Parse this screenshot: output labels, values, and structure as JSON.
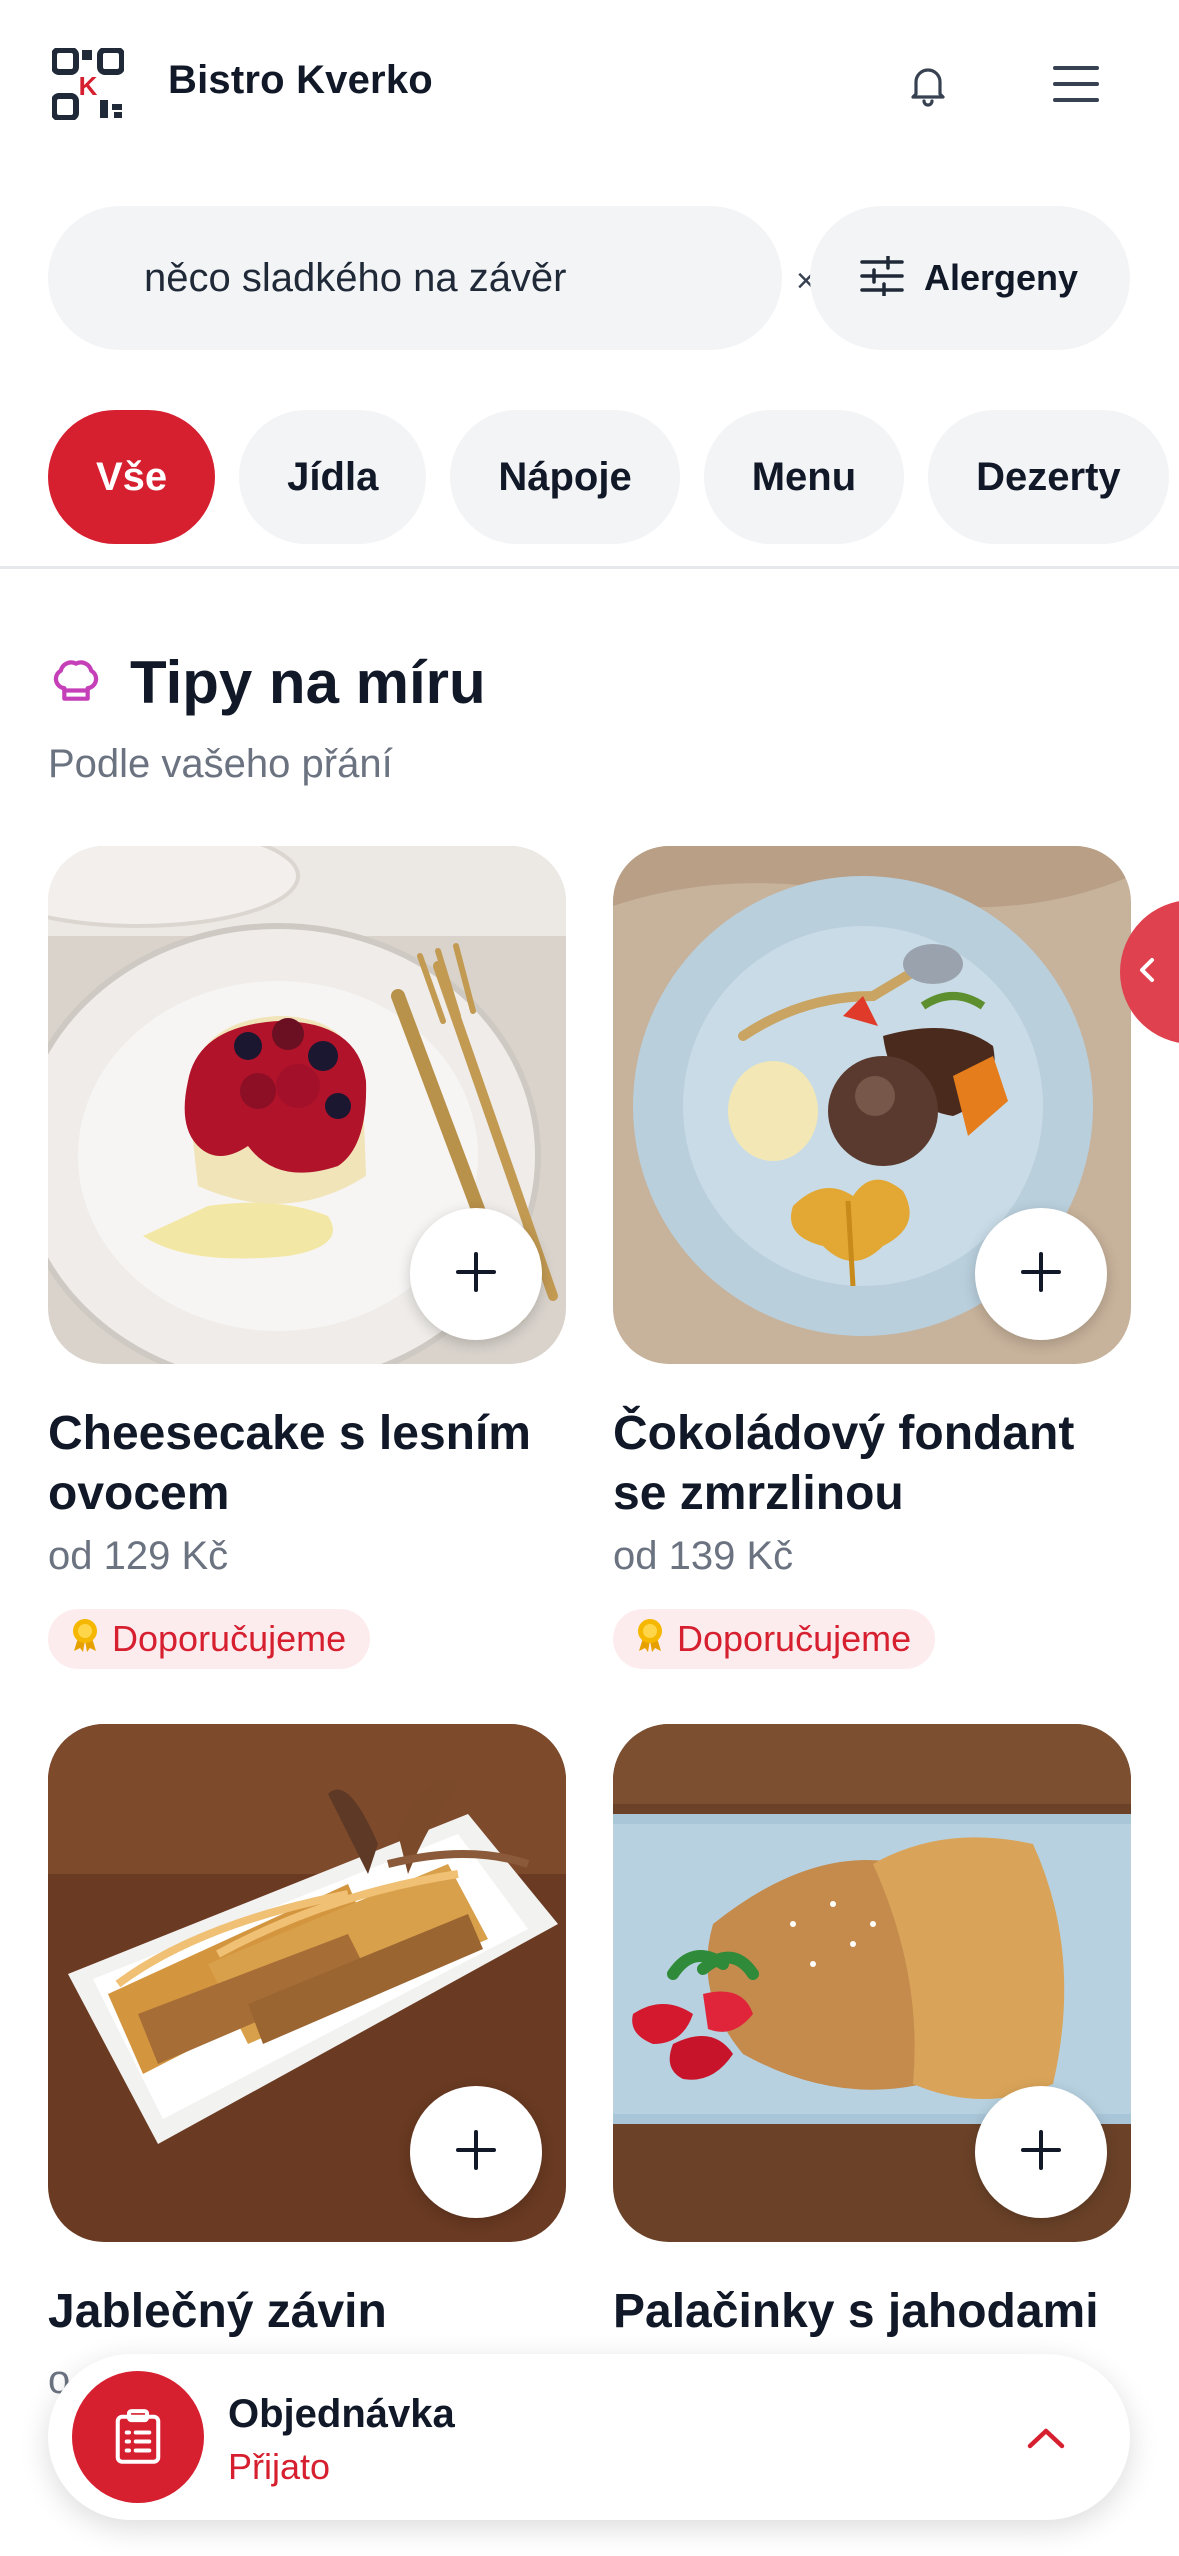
{
  "header": {
    "brand": "Bistro Kverko"
  },
  "search": {
    "query": "něco sladkého na závěr",
    "clear_glyph": "×"
  },
  "filters": {
    "allergens_label": "Alergeny"
  },
  "categories": [
    {
      "label": "Vše",
      "active": true
    },
    {
      "label": "Jídla",
      "active": false
    },
    {
      "label": "Nápoje",
      "active": false
    },
    {
      "label": "Menu",
      "active": false
    },
    {
      "label": "Dezerty",
      "active": false
    }
  ],
  "section": {
    "title": "Tipy na míru",
    "subtitle": "Podle vašeho přání"
  },
  "products": [
    {
      "name": "Cheesecake s lesním ovocem",
      "price": "od 129 Kč",
      "badge": "Doporučujeme"
    },
    {
      "name": "Čokoládový fondant se zmrzlinou",
      "price": "od 139 Kč",
      "badge": "Doporučujeme"
    },
    {
      "name": "Jablečný závin",
      "price": ""
    },
    {
      "name": "Palačinky s jahodami",
      "price": ""
    }
  ],
  "order": {
    "title": "Objednávka",
    "status": "Přijato"
  },
  "colors": {
    "accent": "#d61f2f",
    "chip_bg": "#f3f4f6",
    "badge_bg": "#fdecee",
    "chef_icon": "#c43fb8"
  },
  "icons": [
    "qr-logo-icon",
    "bell-icon",
    "hamburger-menu-icon",
    "sliders-icon",
    "chef-hat-icon",
    "plus-icon",
    "award-icon",
    "chevron-left-icon",
    "clipboard-icon",
    "chevron-up-icon"
  ]
}
